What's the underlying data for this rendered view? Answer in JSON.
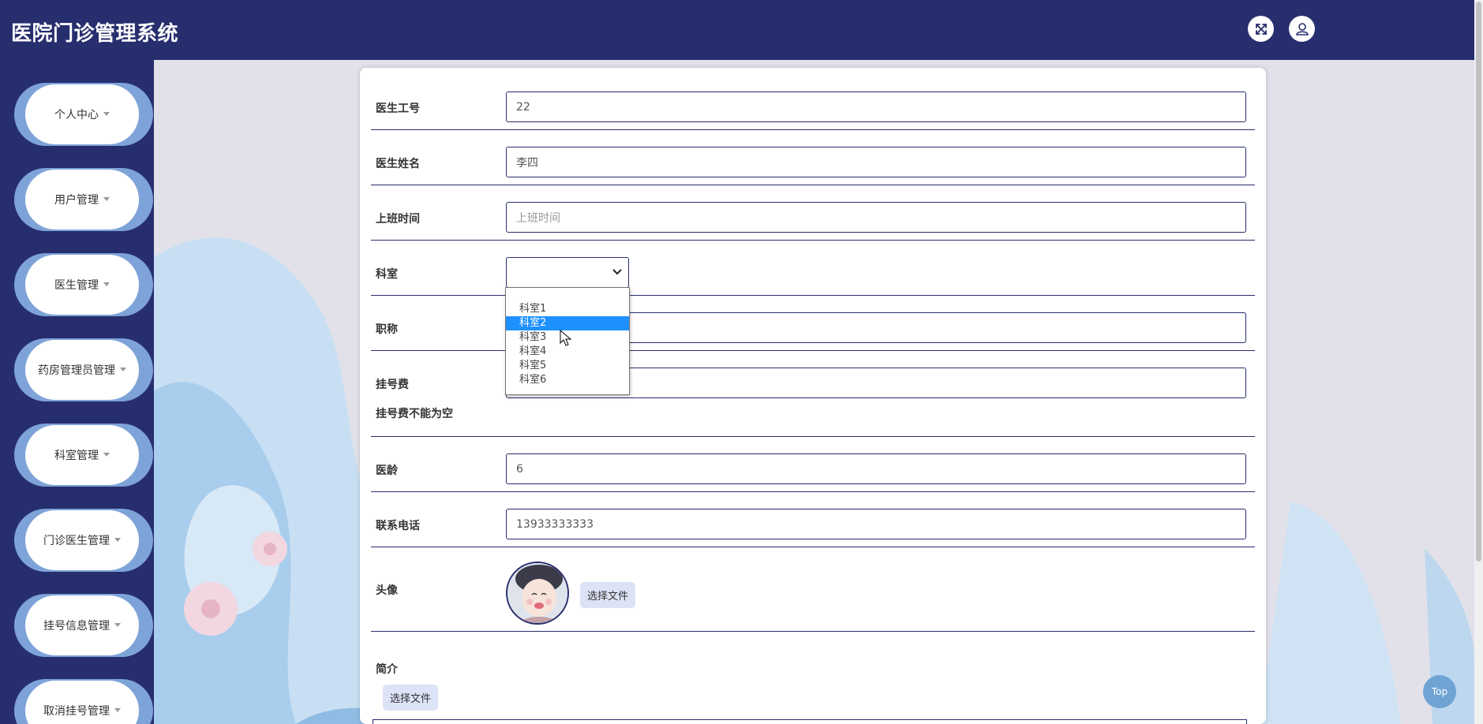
{
  "header": {
    "title": "医院门诊管理系统",
    "fullscreen_icon": "fullscreen-expand-icon",
    "user_icon": "user-icon"
  },
  "sidebar": {
    "items": [
      {
        "label": "个人中心"
      },
      {
        "label": "用户管理"
      },
      {
        "label": "医生管理"
      },
      {
        "label": "药房管理员管理"
      },
      {
        "label": "科室管理"
      },
      {
        "label": "门诊医生管理"
      },
      {
        "label": "挂号信息管理"
      },
      {
        "label": "取消挂号管理"
      }
    ]
  },
  "form": {
    "doctor_id": {
      "label": "医生工号",
      "value": "22"
    },
    "doctor_name": {
      "label": "医生姓名",
      "value": "李四"
    },
    "work_time": {
      "label": "上班时间",
      "placeholder": "上班时间"
    },
    "department": {
      "label": "科室",
      "value": "",
      "options": [
        "科室1",
        "科室2",
        "科室3",
        "科室4",
        "科室5",
        "科室6"
      ],
      "highlighted": "科室2"
    },
    "title": {
      "label": "职称",
      "value": ""
    },
    "fee": {
      "label": "挂号费",
      "value": "",
      "error": "挂号费不能为空"
    },
    "years": {
      "label": "医龄",
      "value": "6"
    },
    "phone": {
      "label": "联系电话",
      "value": "13933333333"
    },
    "avatar": {
      "label": "头像",
      "button": "选择文件"
    },
    "intro": {
      "label": "简介",
      "button": "选择文件"
    }
  },
  "top_button": "Top",
  "colors": {
    "navy": "#272e6e",
    "nav_accent": "#7ea3d8",
    "highlight": "#1e90ff",
    "file_button": "#dde3f7"
  }
}
